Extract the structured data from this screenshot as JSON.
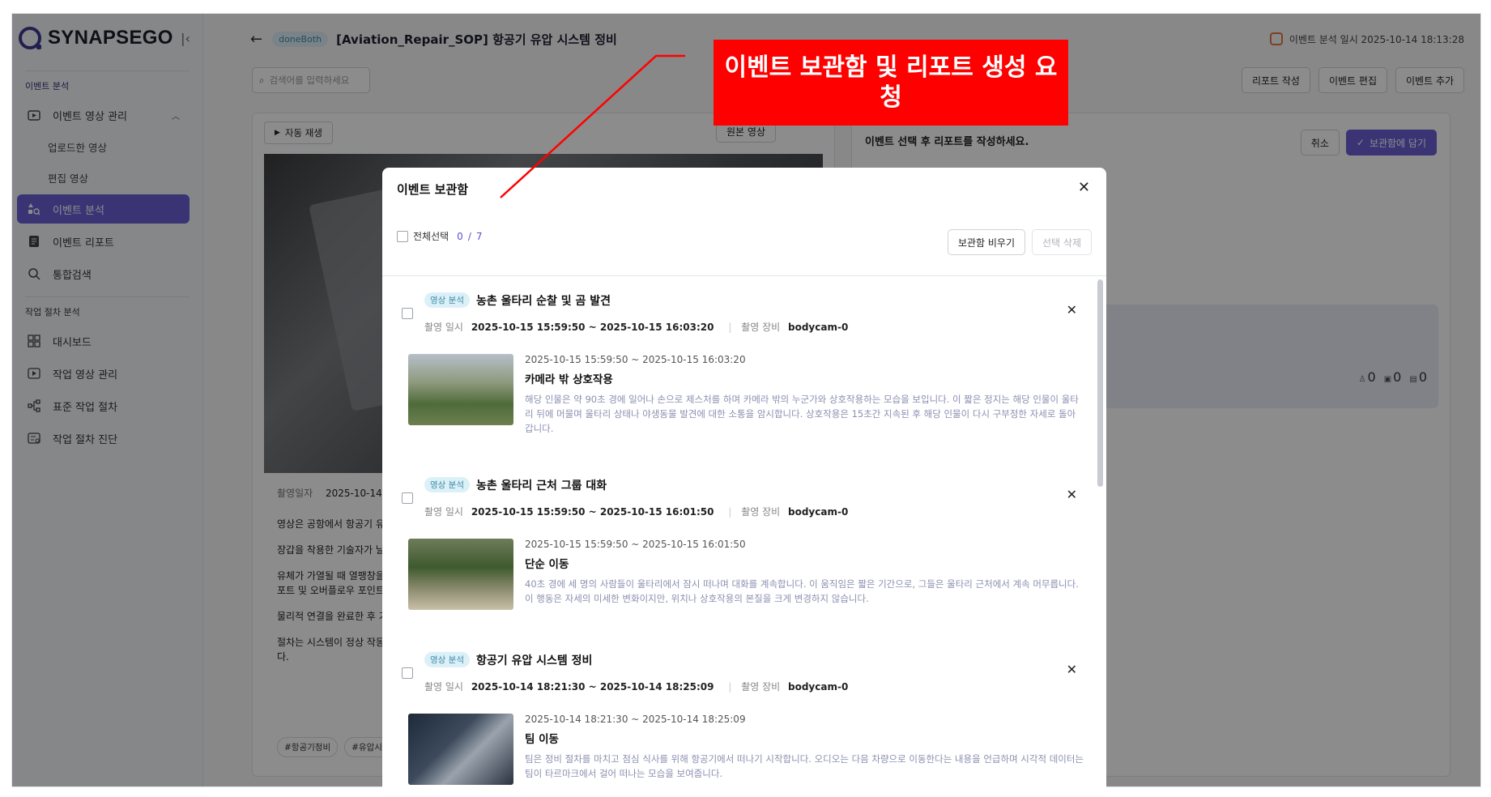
{
  "app": {
    "logo": "SYNAPSEGO",
    "collapse_icon": "collapse-left-icon"
  },
  "sidebar": {
    "section1": "이벤트 분석",
    "items1": [
      {
        "label": "이벤트 영상 관리",
        "icon": "video-folder-icon"
      },
      {
        "label": "업로드한 영상"
      },
      {
        "label": "편집 영상"
      },
      {
        "label": "이벤트 분석",
        "icon": "shapes-search-icon",
        "active": true
      },
      {
        "label": "이벤트 리포트",
        "icon": "document-icon"
      },
      {
        "label": "통합검색",
        "icon": "search-icon"
      }
    ],
    "section2": "작업 절차 분석",
    "items2": [
      {
        "label": "대시보드",
        "icon": "dashboard-icon"
      },
      {
        "label": "작업 영상 관리",
        "icon": "video-icon"
      },
      {
        "label": "표준 작업 절차",
        "icon": "flow-icon"
      },
      {
        "label": "작업 절차 진단",
        "icon": "diagnosis-icon"
      }
    ]
  },
  "header": {
    "badge": "doneBoth",
    "title": "[Aviation_Repair_SOP] 항공기 유압 시스템 정비",
    "analysis_time": "이벤트 분석 일시 2025-10-14 18:13:28"
  },
  "toolbar": {
    "search_placeholder": "검색어를 입력하세요",
    "buttons": [
      "리포트 작성",
      "이벤트 편집",
      "이벤트 추가"
    ]
  },
  "left_panel": {
    "autoplay": "자동 재생",
    "original": "원본 영상",
    "date_label": "촬영일자",
    "date_value": "2025-10-14",
    "lines": [
      "영상은 공항에서 항공기 유",
      "장갑을 착용한 기술자가 날",
      "유체가 가열될 때 열팽창을",
      "포트 및 오버플로우 포인트",
      "물리적 연결을 완료한 후 기",
      "절차는 시스템이 정상 작동",
      "다."
    ],
    "tags": [
      "#항공기정비",
      "#유압시스"
    ]
  },
  "right_panel": {
    "instruction": "이벤트 선택 후 리포트를 작성하세요.",
    "cancel": "취소",
    "add_to_box": "보관함에 담기",
    "counts": [
      "0",
      "0",
      "0"
    ]
  },
  "modal": {
    "title": "이벤트 보관함",
    "select_all": "전체선택",
    "selected": "0",
    "slash": "/",
    "total": "7",
    "empty_box": "보관함 비우기",
    "delete_selected": "선택 삭제",
    "events": [
      {
        "badge": "영상 분석",
        "title": "농촌 울타리 순찰 및 곰 발견",
        "time_label": "촬영 일시",
        "time": "2025-10-15 15:59:50 ~ 2025-10-15 16:03:20",
        "device_label": "촬영 장비",
        "device": "bodycam-0",
        "clip_time": "2025-10-15 15:59:50 ~ 2025-10-15 16:03:20",
        "clip_title": "카메라 밖 상호작용",
        "clip_desc": "해당 인물은 약 90초 경에 일어나 손으로 제스처를 하며 카메라 밖의 누군가와 상호작용하는 모습을 보입니다. 이 짧은 정지는 해당 인물이 울타리 뒤에 머물며 울타리 상태나 야생동물 발견에 대한 소통을 암시합니다. 상호작용은 15초간 지속된 후 해당 인물이 다시 구부정한 자세로 돌아갑니다."
      },
      {
        "badge": "영상 분석",
        "title": "농촌 울타리 근처 그룹 대화",
        "time_label": "촬영 일시",
        "time": "2025-10-15 15:59:50 ~ 2025-10-15 16:01:50",
        "device_label": "촬영 장비",
        "device": "bodycam-0",
        "clip_time": "2025-10-15 15:59:50 ~ 2025-10-15 16:01:50",
        "clip_title": "단순 이동",
        "clip_desc": "40초 경에 세 명의 사람들이 울타리에서 잠시 떠나며 대화를 계속합니다. 이 움직임은 짧은 기간으로, 그들은 울타리 근처에서 계속 머무릅니다. 이 행동은 자세의 미세한 변화이지만, 위치나 상호작용의 본질을 크게 변경하지 않습니다."
      },
      {
        "badge": "영상 분석",
        "title": "항공기 유압 시스템 정비",
        "time_label": "촬영 일시",
        "time": "2025-10-14 18:21:30 ~ 2025-10-14 18:25:09",
        "device_label": "촬영 장비",
        "device": "bodycam-0",
        "clip_time": "2025-10-14 18:21:30 ~ 2025-10-14 18:25:09",
        "clip_title": "팀 이동",
        "clip_desc": "팀은 정비 절차를 마치고 점심 식사를 위해 항공기에서 떠나기 시작합니다. 오디오는 다음 차량으로 이동한다는 내용을 언급하며 시각적 데이터는 팀이 타르마크에서 걸어 떠나는 모습을 보여줍니다."
      }
    ]
  },
  "annotation": {
    "text": "이벤트 보관함 및 리포트 생성 요청",
    "color": "#ff0000"
  }
}
